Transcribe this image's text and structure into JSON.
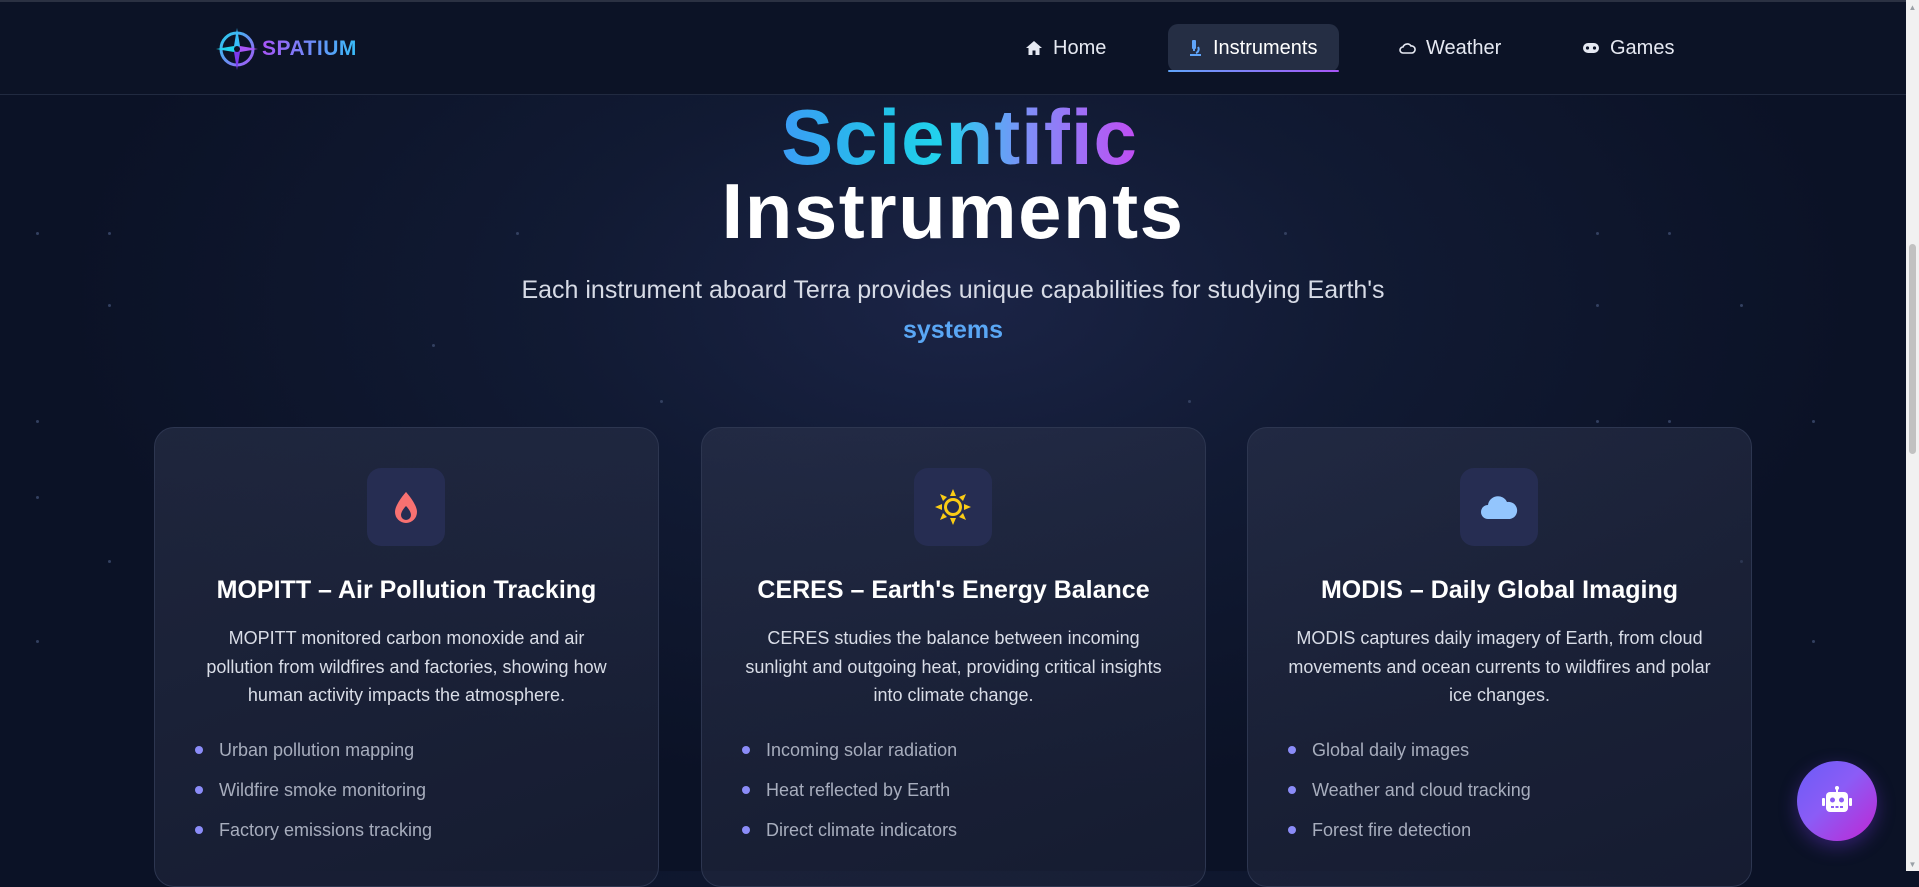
{
  "brand": {
    "name": "SPATIUM"
  },
  "nav": {
    "items": [
      {
        "label": "Home",
        "icon": "home-icon"
      },
      {
        "label": "Instruments",
        "icon": "microscope-icon",
        "active": true
      },
      {
        "label": "Weather",
        "icon": "cloud-icon"
      },
      {
        "label": "Games",
        "icon": "gamepad-icon"
      }
    ]
  },
  "hero": {
    "title_gradient": "Scientific",
    "title_plain": "Instruments",
    "subtitle": "Each instrument aboard Terra provides unique capabilities for studying Earth's",
    "subtitle_highlight": "systems"
  },
  "cards": [
    {
      "icon": "droplet-icon",
      "icon_color": "#f87171",
      "title": "MOPITT – Air Pollution Tracking",
      "description": "MOPITT monitored carbon monoxide and air pollution from wildfires and factories, showing how human activity impacts the atmosphere.",
      "features": [
        "Urban pollution mapping",
        "Wildfire smoke monitoring",
        "Factory emissions tracking"
      ]
    },
    {
      "icon": "sun-icon",
      "icon_color": "#facc15",
      "title": "CERES – Earth's Energy Balance",
      "description": "CERES studies the balance between incoming sunlight and outgoing heat, providing critical insights into climate change.",
      "features": [
        "Incoming solar radiation",
        "Heat reflected by Earth",
        "Direct climate indicators"
      ]
    },
    {
      "icon": "cloud-icon",
      "icon_color": "#93c5fd",
      "title": "MODIS – Daily Global Imaging",
      "description": "MODIS captures daily imagery of Earth, from cloud movements and ocean currents to wildfires and polar ice changes.",
      "features": [
        "Global daily images",
        "Weather and cloud tracking",
        "Forest fire detection"
      ]
    }
  ],
  "chat": {
    "icon": "robot-icon"
  },
  "colors": {
    "accent_blue": "#5aa7f5",
    "accent_purple": "#a855f7",
    "bullet": "#8b8cf8",
    "background": "#0b1226"
  }
}
